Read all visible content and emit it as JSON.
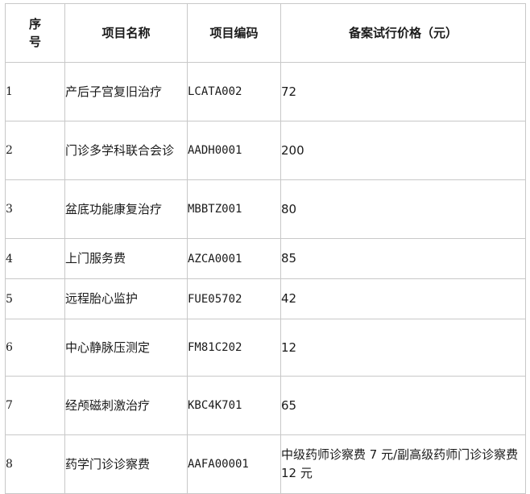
{
  "table": {
    "headers": {
      "seq": "序\n号",
      "name": "项目名称",
      "code": "项目编码",
      "price": "备案试行价格（元）"
    },
    "rows": [
      {
        "seq": "1",
        "name": "产后子宫复旧治疗",
        "code": "LCATA002",
        "price": "72"
      },
      {
        "seq": "2",
        "name": "门诊多学科联合会诊",
        "code": "AADH0001",
        "price": "200"
      },
      {
        "seq": "3",
        "name": "盆底功能康复治疗",
        "code": "MBBTZ001",
        "price": "80"
      },
      {
        "seq": "4",
        "name": "上门服务费",
        "code": "AZCA0001",
        "price": "85"
      },
      {
        "seq": "5",
        "name": "远程胎心监护",
        "code": "FUE05702",
        "price": "42"
      },
      {
        "seq": "6",
        "name": "中心静脉压测定",
        "code": "FM81C202",
        "price": "12"
      },
      {
        "seq": "7",
        "name": "经颅磁刺激治疗",
        "code": "KBC4K701",
        "price": "65"
      },
      {
        "seq": "8",
        "name": "药学门诊诊察费",
        "code": "AAFA00001",
        "price": "中级药师诊察费 7 元/副高级药师门诊诊察费 12 元"
      }
    ]
  }
}
